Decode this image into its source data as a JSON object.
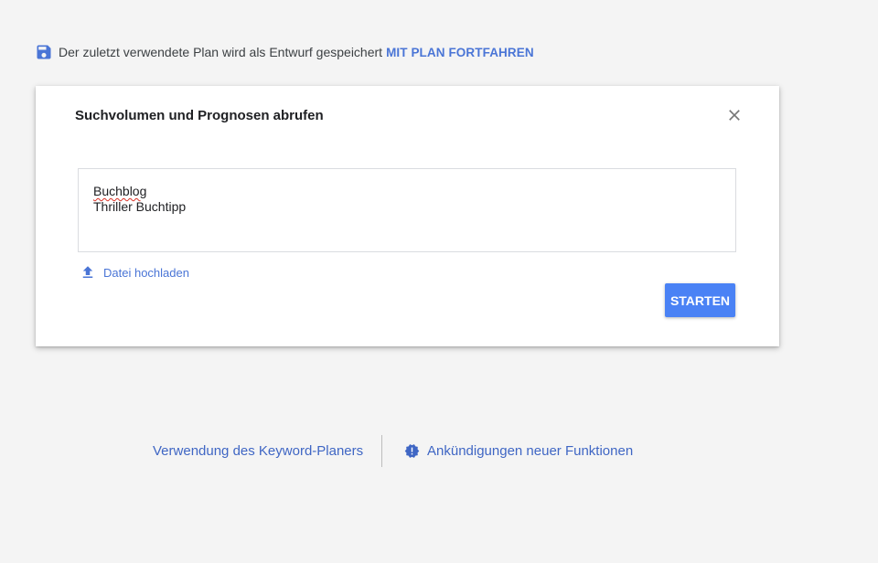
{
  "draft_notice": {
    "text": "Der zuletzt verwendete Plan wird als Entwurf gespeichert",
    "continue_label": "MIT PLAN FORTFAHREN",
    "icon": "save-icon"
  },
  "dialog": {
    "title": "Suchvolumen und Prognosen abrufen",
    "close_icon": "close-icon",
    "keywords": [
      "Buchblog",
      "Thriller Buchtipp"
    ],
    "upload_label": "Datei hochladen",
    "upload_icon": "upload-icon",
    "start_label": "STARTEN"
  },
  "footer": {
    "usage_link": "Verwendung des Keyword-Planers",
    "announcements_link": "Ankündigungen neuer Funktionen",
    "announcements_icon": "new-badge-icon"
  },
  "colors": {
    "accent": "#4a75d6",
    "button": "#4a82f5",
    "background": "#f4f4f4"
  }
}
